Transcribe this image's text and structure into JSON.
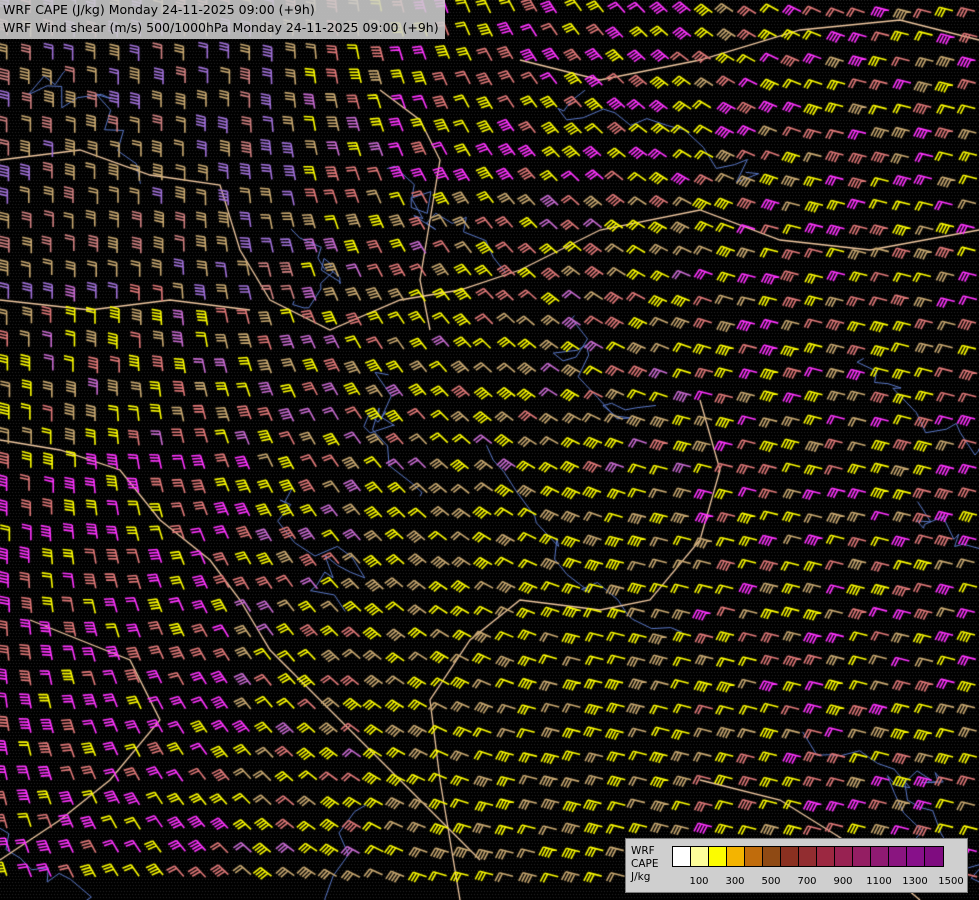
{
  "header": {
    "title_line1": "WRF CAPE (J/kg) Monday 24-11-2025 09:00 (+9h)",
    "title_line2": "WRF Wind shear (m/s) 500/1000hPa Monday 24-11-2025 09:00 (+9h)"
  },
  "legend": {
    "label_line1": "WRF",
    "label_line2": "CAPE",
    "label_line3": "J/kg",
    "colors": [
      "#ffffff",
      "#fdfd9a",
      "#fcfc00",
      "#f4b400",
      "#c06c0c",
      "#8f4a14",
      "#8a3020",
      "#922d30",
      "#9c2841",
      "#982252",
      "#941e63",
      "#8f1a72",
      "#8a1580",
      "#87108a",
      "#7f0c80"
    ],
    "ticks": [
      "100",
      "300",
      "500",
      "700",
      "900",
      "1100",
      "1300",
      "1500"
    ]
  },
  "map": {
    "background": "#000000",
    "barb_colors": [
      "#fcfc00",
      "#c8a870",
      "#e07878",
      "#c76ad0",
      "#ff33ff",
      "#a070d8",
      "#d08080"
    ],
    "border_color": "#f0c8a0",
    "river_color": "#5a78c8"
  }
}
